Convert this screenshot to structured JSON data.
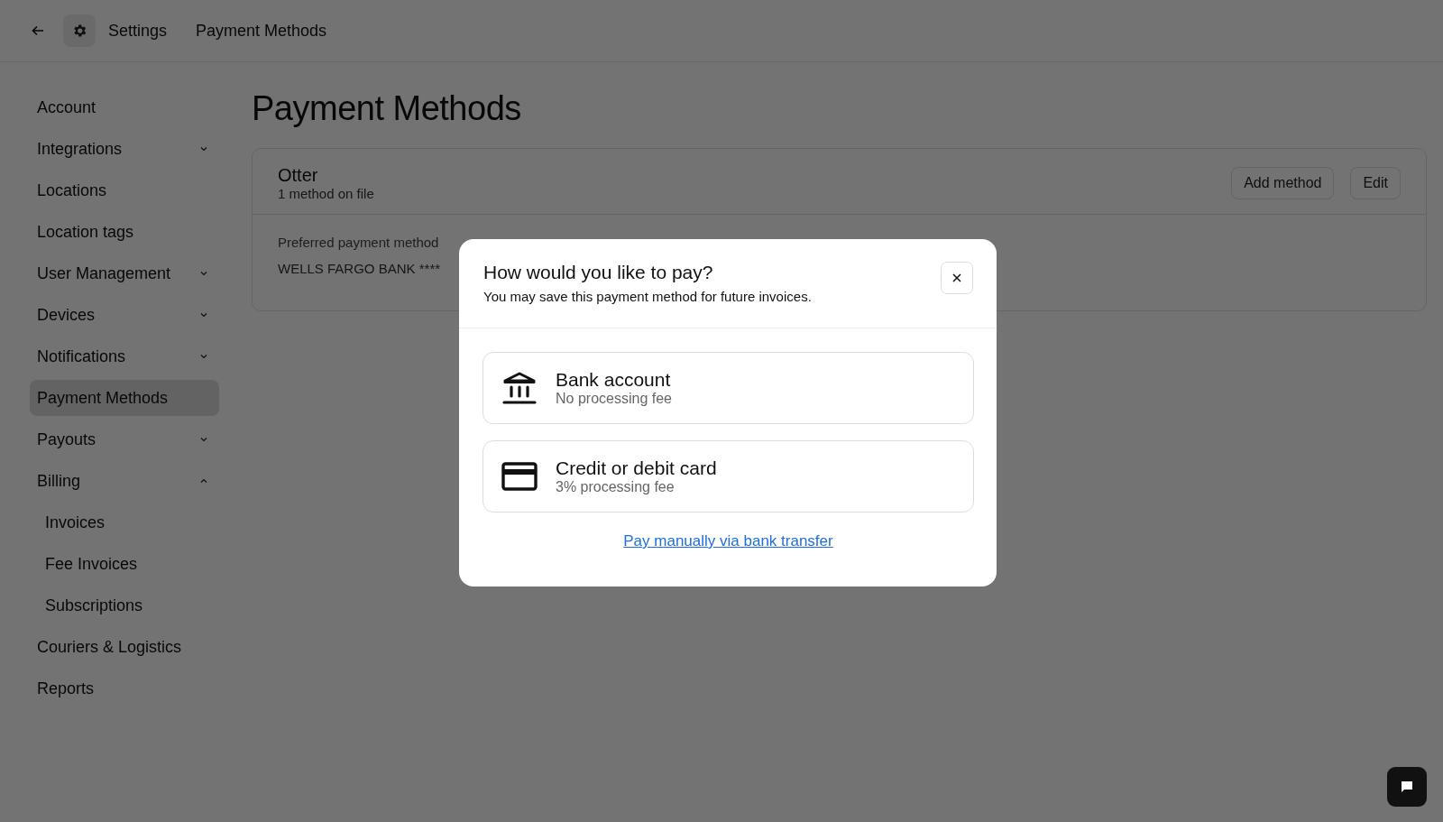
{
  "header": {
    "breadcrumbs": [
      "Settings",
      "Payment Methods"
    ]
  },
  "sidebar": {
    "items": [
      {
        "label": "Account",
        "selected": false
      },
      {
        "label": "Integrations",
        "selected": false,
        "expanded": false
      },
      {
        "label": "Locations",
        "selected": false
      },
      {
        "label": "Location tags",
        "selected": false
      },
      {
        "label": "User Management",
        "selected": false,
        "expanded": false
      },
      {
        "label": "Devices",
        "selected": false,
        "expanded": false
      },
      {
        "label": "Notifications",
        "selected": false,
        "expanded": false
      },
      {
        "label": "Payment Methods",
        "selected": true
      },
      {
        "label": "Payouts",
        "selected": false,
        "expanded": false
      },
      {
        "label": "Billing",
        "selected": false,
        "expanded": true,
        "children": [
          {
            "label": "Invoices",
            "selected": false
          },
          {
            "label": "Fee Invoices",
            "selected": false
          },
          {
            "label": "Subscriptions",
            "selected": false
          }
        ]
      },
      {
        "label": "Couriers & Logistics",
        "selected": false
      },
      {
        "label": "Reports",
        "selected": false
      }
    ]
  },
  "page_title": "Payment Methods",
  "account_card": {
    "name": "Otter",
    "subtitle": "1 method on file",
    "buttons": [
      "Add method",
      "Edit"
    ],
    "preferred_label": "Preferred payment method",
    "preferred_value": "WELLS FARGO BANK ****"
  },
  "dialog": {
    "title": "How would you like to pay?",
    "subtitle": "You may save this payment method for future invoices.",
    "options": [
      {
        "kind": "bank",
        "title": "Bank account",
        "note": "No processing fee"
      },
      {
        "kind": "card",
        "title": "Credit or debit card",
        "note": "3% processing fee"
      }
    ],
    "link": "Pay manually via bank transfer"
  }
}
